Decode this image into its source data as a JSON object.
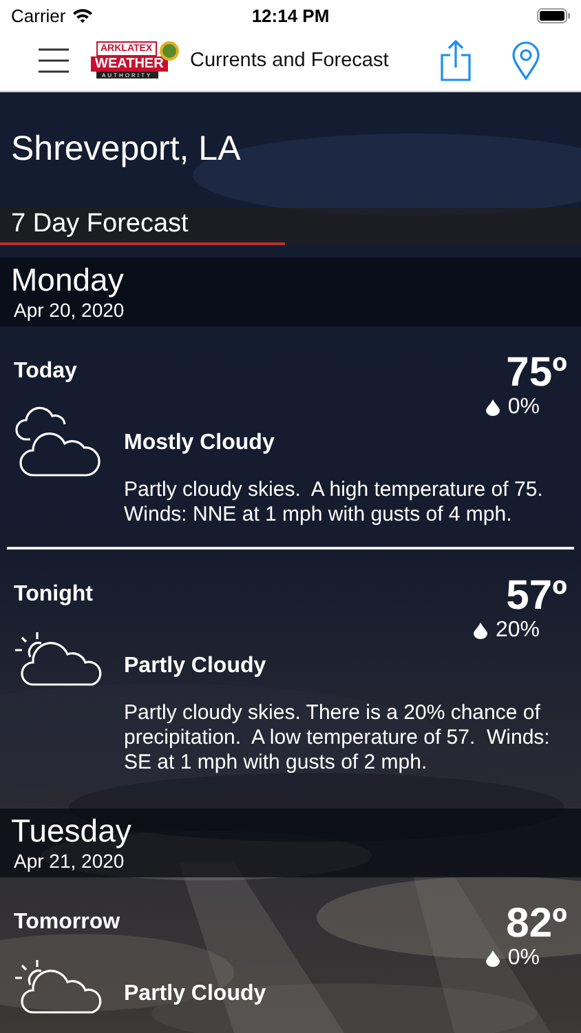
{
  "status_bar": {
    "carrier": "Carrier",
    "time": "12:14 PM"
  },
  "nav": {
    "logo": [
      "ARKLATEX",
      "WEATHER",
      "AUTHORITY"
    ],
    "title": "Currents and Forecast"
  },
  "location": "Shreveport, LA",
  "section_title": "7 Day Forecast",
  "days": [
    {
      "name": "Monday",
      "date": "Apr 20, 2020",
      "periods": [
        {
          "name": "Today",
          "temp": "75º",
          "precip": "0%",
          "kind": "mostly_cloudy",
          "condition": "Mostly Cloudy",
          "description": "Partly cloudy skies.  A high temperature of 75.  Winds: NNE at 1 mph with gusts of 4 mph."
        },
        {
          "name": "Tonight",
          "temp": "57º",
          "precip": "20%",
          "kind": "partly_cloudy",
          "condition": "Partly Cloudy",
          "description": "Partly cloudy skies. There is a 20% chance of precipitation.  A low temperature of 57.  Winds: SE at 1 mph with gusts of 2 mph."
        }
      ]
    },
    {
      "name": "Tuesday",
      "date": "Apr 21, 2020",
      "periods": [
        {
          "name": "Tomorrow",
          "temp": "82º",
          "precip": "0%",
          "kind": "partly_cloudy",
          "condition": "Partly Cloudy"
        }
      ]
    }
  ]
}
